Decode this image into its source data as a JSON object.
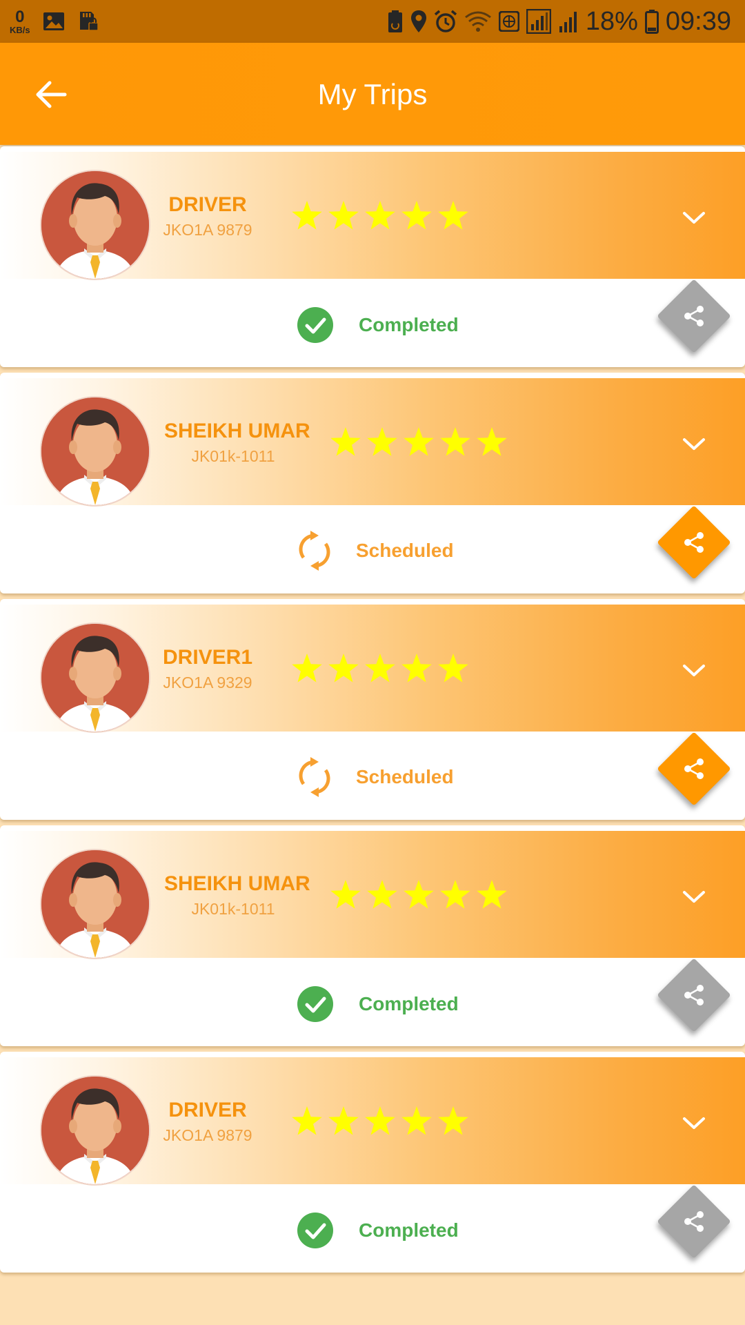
{
  "status_bar": {
    "speed_value": "0",
    "speed_unit": "KB/s",
    "battery_percent": "18%",
    "time": "09:39"
  },
  "app_bar": {
    "title": "My Trips"
  },
  "colors": {
    "accent": "#ff9806",
    "completed": "#4caf50",
    "scheduled": "#f7a030",
    "share_inactive": "#a6a6a6",
    "share_active": "#ff9800",
    "star": "#ffff00"
  },
  "trips": [
    {
      "driver_name": "DRIVER",
      "vehicle_number": "JKO1A 9879",
      "rating": 5,
      "status": "Completed",
      "status_type": "completed"
    },
    {
      "driver_name": "SHEIKH UMAR",
      "vehicle_number": "JK01k-1011",
      "rating": 5,
      "status": "Scheduled",
      "status_type": "scheduled"
    },
    {
      "driver_name": "DRIVER1",
      "vehicle_number": "JKO1A 9329",
      "rating": 5,
      "status": "Scheduled",
      "status_type": "scheduled"
    },
    {
      "driver_name": "SHEIKH UMAR",
      "vehicle_number": "JK01k-1011",
      "rating": 5,
      "status": "Completed",
      "status_type": "completed"
    },
    {
      "driver_name": "DRIVER",
      "vehicle_number": "JKO1A 9879",
      "rating": 5,
      "status": "Completed",
      "status_type": "completed"
    }
  ]
}
